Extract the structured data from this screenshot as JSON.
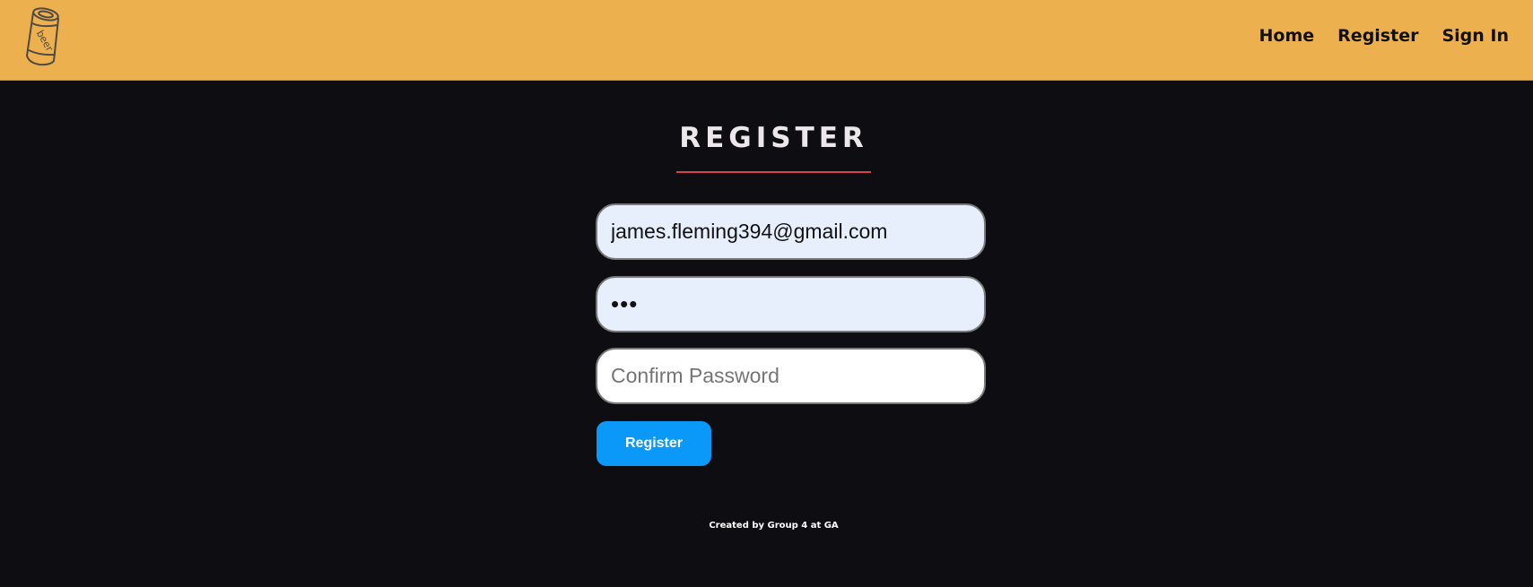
{
  "navbar": {
    "background_color": "#edb04f",
    "logo": {
      "icon": "beer-can-icon",
      "text": "beer"
    },
    "links": [
      {
        "label": "Home"
      },
      {
        "label": "Register"
      },
      {
        "label": "Sign In"
      }
    ]
  },
  "main": {
    "title": "REGISTER",
    "accent_color": "#d6424c",
    "form": {
      "email": {
        "value": "james.fleming394@gmail.com",
        "placeholder": ""
      },
      "password": {
        "value": "•••",
        "placeholder": ""
      },
      "confirm_password": {
        "value": "",
        "placeholder": "Confirm Password"
      },
      "submit_label": "Register",
      "submit_color": "#0a99f8"
    }
  },
  "footer": {
    "text": "Created by Group 4 at GA"
  }
}
